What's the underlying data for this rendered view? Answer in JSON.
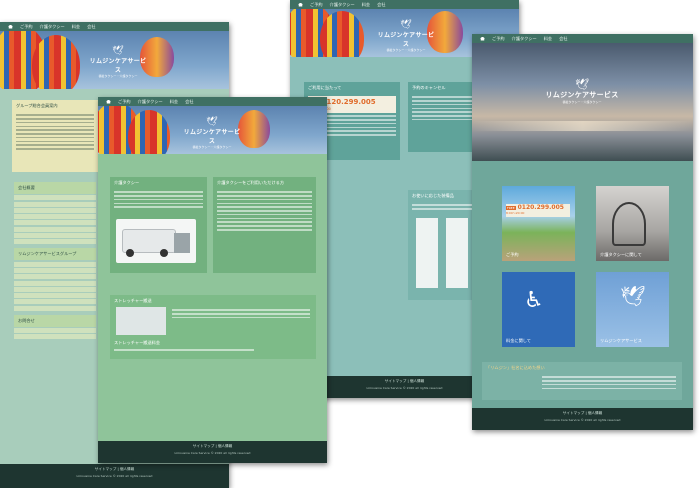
{
  "nav": {
    "home": "ホーム",
    "items": [
      "ご予約",
      "介護タクシー",
      "料金",
      "会社"
    ]
  },
  "logo": {
    "title": "リムジンケアサービス",
    "subtitle": "福祉タクシー・介護タクシー"
  },
  "page1": {
    "group_title": "グループ総合会員案内",
    "sidebar_title": "会社概要",
    "sidebar_group_title": "リムジンケアサービスグループ",
    "contact_title": "お問合せ",
    "footer_nav": "サイトマップ | 個人情報",
    "copyright": "Limousine Care Service © 2020 all rights reserved"
  },
  "page2": {
    "sec1_title": "介護タクシー",
    "sec2_title": "介護タクシーをご利用いただける方",
    "sec3_title": "ストレッチャー搬送",
    "sec3_sub": "ストレッチャー搬送料金",
    "footer_nav": "サイトマップ | 個人情報",
    "copyright": "Limousine Care Service © 2020 all rights reserved"
  },
  "page3": {
    "about_title": "ご利用に当たって",
    "phone": "0120.299.005",
    "phone_hours": "8:00〜20:00",
    "cancel_title": "予約のキャンセル",
    "equipment_title": "お使いに応じた装備品",
    "footer_nav": "サイトマップ | 個人情報",
    "copyright": "Limousine Care Service © 2020 all rights reserved"
  },
  "page4": {
    "tiles": [
      {
        "label": "ご予約",
        "phone": "0120.299.005",
        "hours": "8:00〜20:00"
      },
      {
        "label": "介護タクシーに関して"
      },
      {
        "label": "料金に関して"
      },
      {
        "label": "リムジンケアサービス"
      }
    ],
    "about_title": "「リムジン」社名に込めた想い",
    "footer_nav": "サイトマップ | 個人情報",
    "copyright": "Limousine Care Service © 2020 all rights reserved"
  },
  "colors": {
    "nav": "#3f7063",
    "teal": "#7fb5ad",
    "green": "#8fc49a",
    "footer": "#1e3530",
    "accent": "#e06c2c"
  },
  "icons": [
    "home-icon",
    "bird-logo-icon",
    "phone-icon"
  ]
}
